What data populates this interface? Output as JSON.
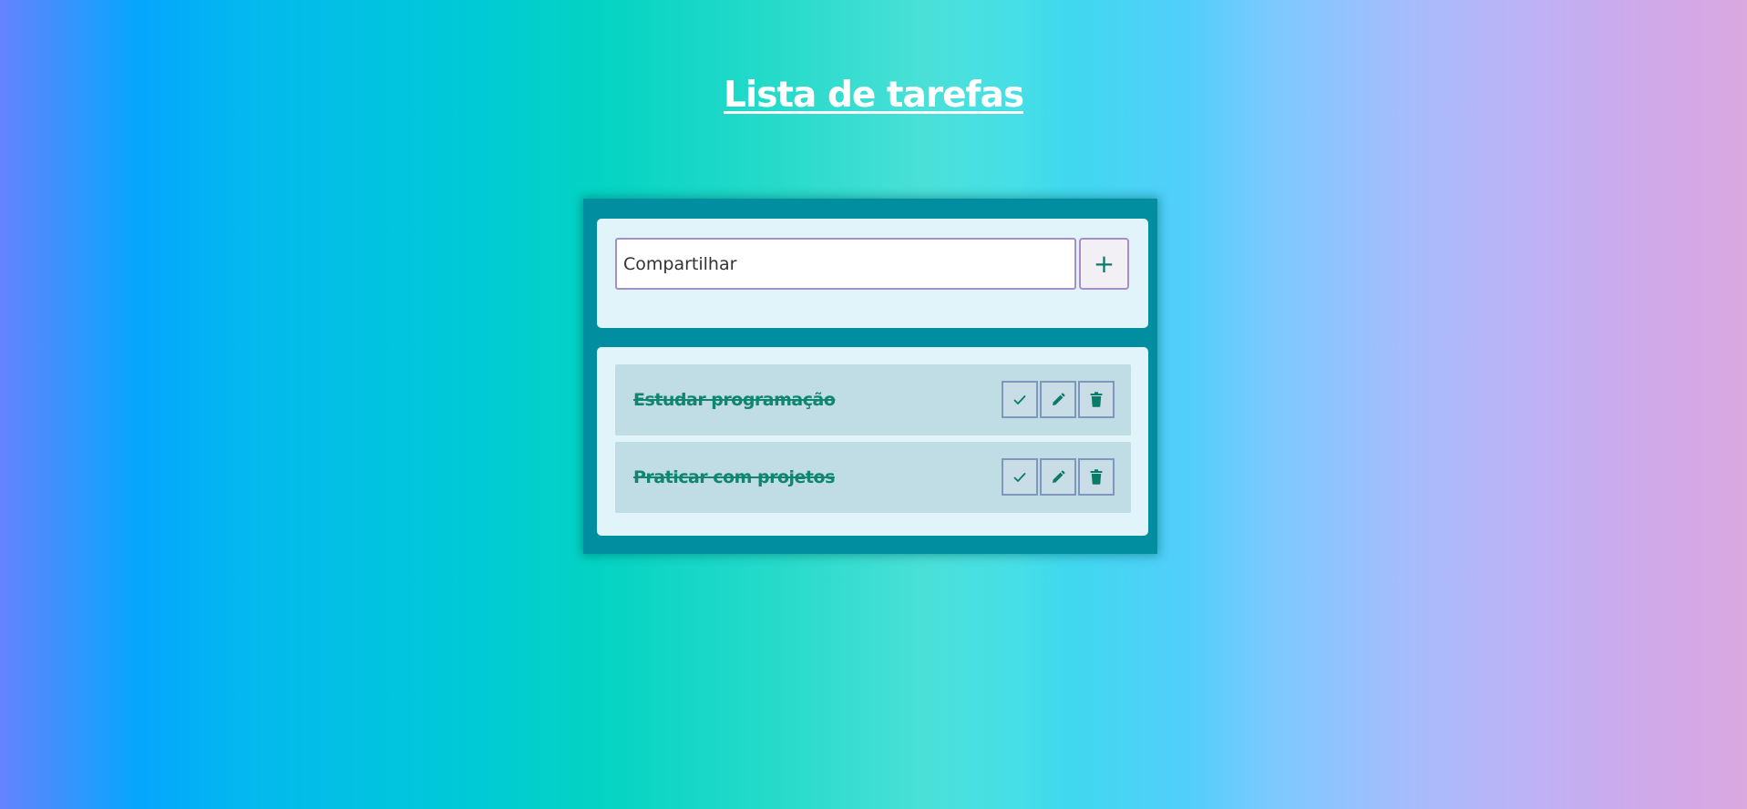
{
  "header": {
    "title": "Lista de tarefas"
  },
  "form": {
    "input_value": "Compartilhar",
    "add_button_label": "+"
  },
  "tasks": [
    {
      "text": "Estudar programação",
      "completed": true,
      "actions": [
        "check-icon",
        "pencil-icon",
        "trash-icon"
      ]
    },
    {
      "text": "Praticar com projetos",
      "completed": true,
      "actions": [
        "check-icon",
        "pencil-icon",
        "trash-icon"
      ]
    }
  ],
  "colors": {
    "card_background": "#008ea0",
    "panel_background": "#e0f4fa",
    "task_background": "#c0dce5",
    "task_text": "#10866e",
    "icon_color": "#0a7a6a",
    "input_border": "#a68fc6",
    "button_border": "#7f97bd",
    "title_color": "#ffffff"
  }
}
